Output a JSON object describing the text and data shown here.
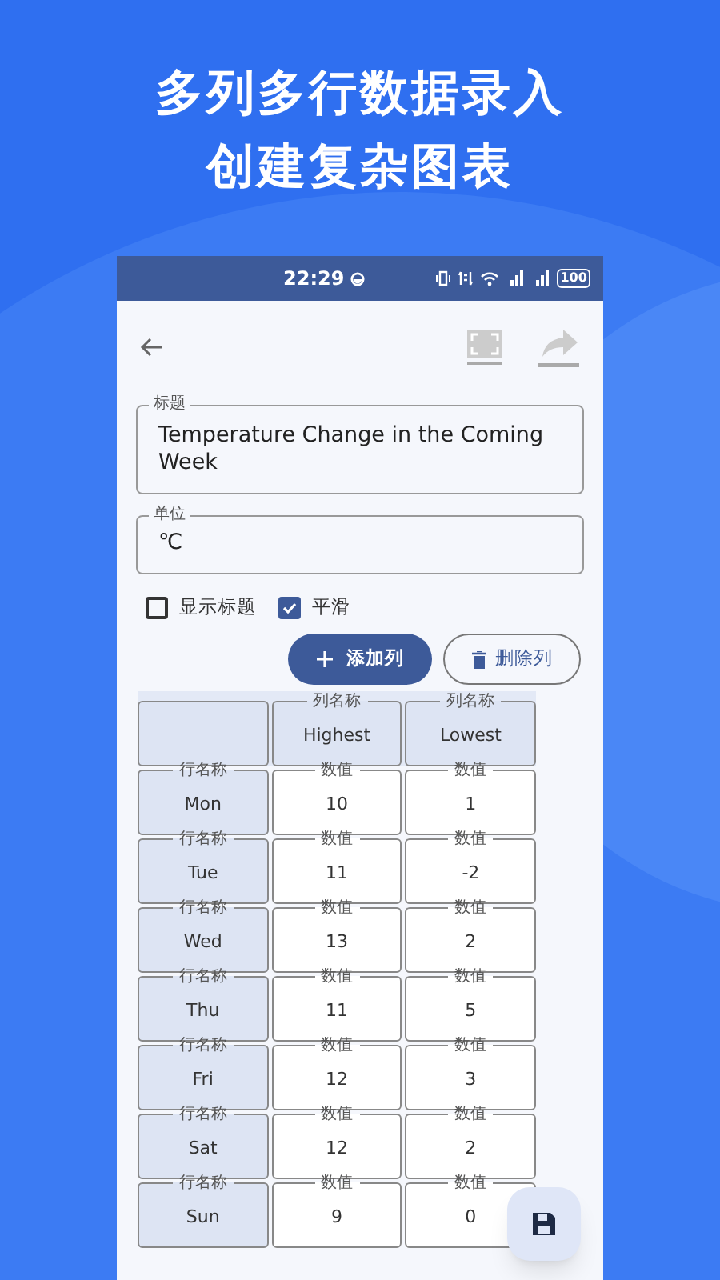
{
  "headline": [
    "多列多行数据录入",
    "创建复杂图表"
  ],
  "status_bar": {
    "time": "22:29",
    "battery": "100"
  },
  "title_field": {
    "label": "标题",
    "value": "Temperature Change in the Coming Week"
  },
  "unit_field": {
    "label": "单位",
    "value": "℃"
  },
  "options": [
    {
      "label": "显示标题",
      "checked": false
    },
    {
      "label": "平滑",
      "checked": true
    }
  ],
  "buttons": [
    {
      "label": "添加列",
      "kind": "primary"
    },
    {
      "label": "删除列",
      "kind": "outline"
    }
  ],
  "table": {
    "columns": [
      {
        "label": "列名称",
        "value": "Highest"
      },
      {
        "label": "列名称",
        "value": "Lowest"
      }
    ],
    "rows": [
      {
        "label": "行名称",
        "name": "Mon",
        "cells": [
          {
            "label": "数值",
            "value": "10"
          },
          {
            "label": "数值",
            "value": "1"
          }
        ]
      },
      {
        "label": "行名称",
        "name": "Tue",
        "cells": [
          {
            "label": "数值",
            "value": "11"
          },
          {
            "label": "数值",
            "value": "-2"
          }
        ]
      },
      {
        "label": "行名称",
        "name": "Wed",
        "cells": [
          {
            "label": "数值",
            "value": "13"
          },
          {
            "label": "数值",
            "value": "2"
          }
        ]
      },
      {
        "label": "行名称",
        "name": "Thu",
        "cells": [
          {
            "label": "数值",
            "value": "11"
          },
          {
            "label": "数值",
            "value": "5"
          }
        ]
      },
      {
        "label": "行名称",
        "name": "Fri",
        "cells": [
          {
            "label": "数值",
            "value": "12"
          },
          {
            "label": "数值",
            "value": "3"
          }
        ]
      },
      {
        "label": "行名称",
        "name": "Sat",
        "cells": [
          {
            "label": "数值",
            "value": "12"
          },
          {
            "label": "数值",
            "value": "2"
          }
        ]
      },
      {
        "label": "行名称",
        "name": "Sun",
        "cells": [
          {
            "label": "数值",
            "value": "9"
          },
          {
            "label": "数值",
            "value": "0"
          }
        ]
      }
    ]
  }
}
